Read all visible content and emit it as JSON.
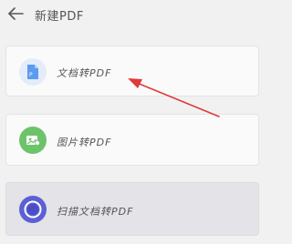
{
  "header": {
    "title": "新建PDF",
    "back_icon": "back-arrow-icon"
  },
  "options": [
    {
      "label": "文档转PDF",
      "icon": "document-icon",
      "icon_color": "#5b9bf0"
    },
    {
      "label": "图片转PDF",
      "icon": "image-icon",
      "icon_color": "#6cc36a"
    },
    {
      "label": "扫描文档转PDF",
      "icon": "scan-icon",
      "icon_color": "#5c5fd6"
    }
  ],
  "annotation": {
    "type": "red-arrow",
    "color": "#e03a3a",
    "points_to": "文档转PDF"
  },
  "colors": {
    "background": "#f1f1f1",
    "card": "#fafafa",
    "scan_card": "#e3e3e8",
    "text": "#555555"
  }
}
